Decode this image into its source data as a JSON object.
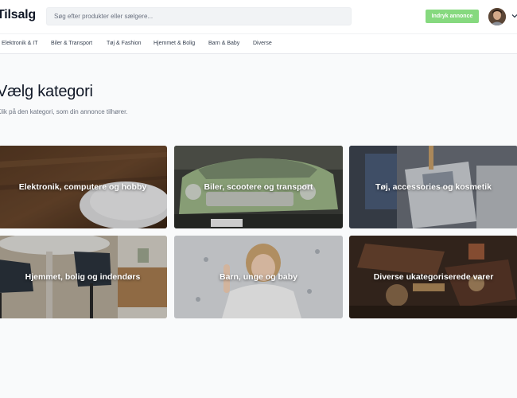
{
  "header": {
    "logo": "Tilsalg",
    "search_placeholder": "Søg efter produkter eller sælgere...",
    "post_button": "Indryk annonce",
    "avatar": "user-avatar",
    "menu_icon": "chevron-down-icon"
  },
  "nav": {
    "items": [
      {
        "label": "Elektronik & IT"
      },
      {
        "label": "Biler & Transport"
      },
      {
        "label": "Tøj & Fashion"
      },
      {
        "label": "Hjemmet & Bolig"
      },
      {
        "label": "Barn & Baby"
      },
      {
        "label": "Diverse"
      }
    ]
  },
  "page": {
    "title": "Vælg kategori",
    "subtitle": "Klik på den kategori, som din annonce tilhører."
  },
  "categories": [
    {
      "label": "Elektronik, computere og hobby"
    },
    {
      "label": "Biler, scootere og transport"
    },
    {
      "label": "Tøj, accessories og kosmetik"
    },
    {
      "label": "Hjemmet, bolig og indendørs"
    },
    {
      "label": "Barn, unge og baby"
    },
    {
      "label": "Diverse ukategoriserede varer"
    }
  ],
  "colors": {
    "accent": "#86d97f",
    "text": "#111827",
    "muted": "#6b7280"
  }
}
